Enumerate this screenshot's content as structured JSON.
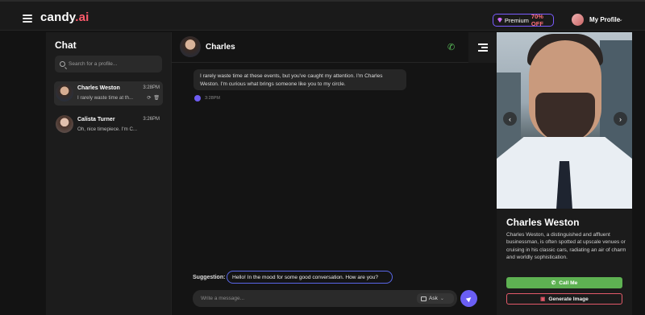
{
  "brand": {
    "name": "candy",
    "suffix": ".ai"
  },
  "topbar": {
    "premium_label": "Premium",
    "premium_offer": "70% OFF",
    "profile_label": "My Profile"
  },
  "sidebar": {
    "title": "Chat",
    "search_placeholder": "Search for a profile...",
    "conversations": [
      {
        "name": "Charles Weston",
        "time": "3:28PM",
        "preview": "I rarely waste time at th..."
      },
      {
        "name": "Calista Turner",
        "time": "3:26PM",
        "preview": "Oh, nice timepiece. I'm C..."
      }
    ]
  },
  "chat": {
    "contact_name": "Charles",
    "messages": [
      {
        "text": "I rarely waste time at these events, but you've caught my attention. I'm Charles Weston. I'm curious what brings someone like you to my circle.",
        "time": "3:28PM"
      }
    ],
    "suggestion_label": "Suggestion:",
    "suggestion_text": "Hello! In the mood for some good conversation. How are you?",
    "composer_placeholder": "Write a message...",
    "ask_label": "Ask"
  },
  "profile": {
    "name": "Charles Weston",
    "bio": "Charles Weston, a distinguished and affluent businessman, is often spotted at upscale venues or cruising in his classic cars, radiating an air of charm and worldly sophistication.",
    "call_label": "Call Me",
    "generate_label": "Generate Image"
  },
  "colors": {
    "accent": "#6a5ef4",
    "call_green": "#5eb152",
    "brand_pink": "#ff5b6c"
  }
}
